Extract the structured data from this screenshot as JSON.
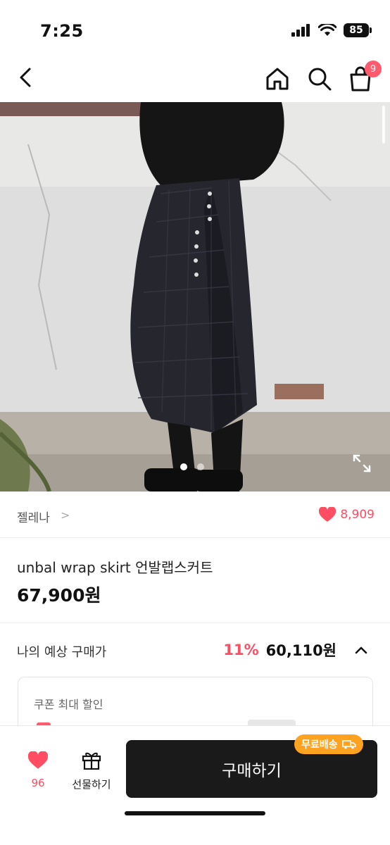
{
  "status_bar": {
    "time": "7:25",
    "battery": "85"
  },
  "nav": {
    "cart_badge": "9"
  },
  "hero": {
    "dots_total": 2,
    "active_dot": 1
  },
  "seller": {
    "name": "젤레나",
    "chevron": ">",
    "likes": "8,909"
  },
  "product": {
    "title": "unbal wrap skirt 언발랩스커트",
    "price": "67,900원"
  },
  "expected": {
    "label": "나의 예상 구매가",
    "discount": "11%",
    "price": "60,110원"
  },
  "coupon": {
    "title": "쿠폰 최대 할인"
  },
  "bottom": {
    "like_count": "96",
    "gift_label": "선물하기",
    "buy_label": "구매하기",
    "free_shipping": "무료배송"
  },
  "colors": {
    "accent": "#ff4d63",
    "badge": "#ffa21f",
    "buy_bg": "#1a1a1a"
  }
}
